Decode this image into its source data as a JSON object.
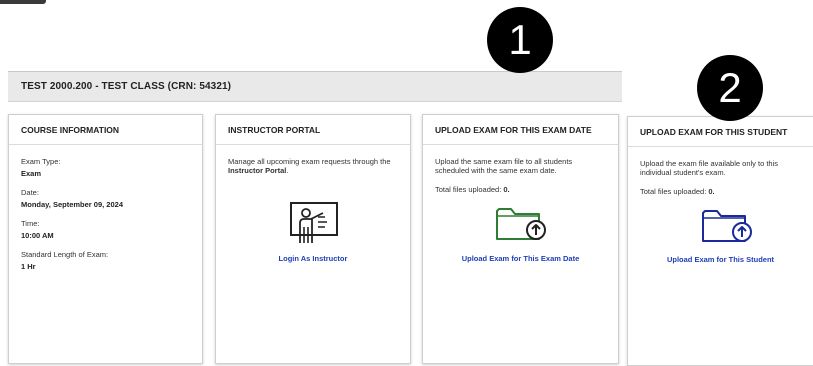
{
  "header": {
    "title": "TEST 2000.200 - TEST CLASS (CRN: 54321)"
  },
  "course_info": {
    "heading": "COURSE INFORMATION",
    "fields": [
      {
        "label": "Exam Type:",
        "value": "Exam"
      },
      {
        "label": "Date:",
        "value": "Monday, September 09, 2024"
      },
      {
        "label": "Time:",
        "value": "10:00 AM"
      },
      {
        "label": "Standard Length of Exam:",
        "value": "1 Hr"
      }
    ]
  },
  "instructor_portal": {
    "heading": "INSTRUCTOR PORTAL",
    "desc_prefix": "Manage all upcoming exam requests through the ",
    "desc_bold": "Instructor Portal",
    "desc_suffix": ".",
    "link": "Login As Instructor",
    "icon": "presenter-board-icon"
  },
  "upload_date": {
    "heading": "UPLOAD EXAM FOR THIS EXAM DATE",
    "desc": "Upload the same exam file to all students scheduled with the same exam date.",
    "count_label": "Total files uploaded: ",
    "count_value": "0.",
    "link": "Upload Exam for This Exam Date",
    "icon": "folder-upload-icon",
    "accent": "#2e7d32"
  },
  "upload_student": {
    "heading": "UPLOAD EXAM FOR THIS STUDENT",
    "desc": "Upload the exam file available only to this individual student's exam.",
    "count_label": "Total files uploaded: ",
    "count_value": "0.",
    "link": "Upload Exam for This Student",
    "icon": "folder-upload-icon",
    "accent": "#1a2a9c"
  },
  "badges": [
    {
      "label": "1"
    },
    {
      "label": "2"
    }
  ],
  "colors": {
    "link": "#1f3fb5",
    "header_bg": "#e9e9e9"
  }
}
